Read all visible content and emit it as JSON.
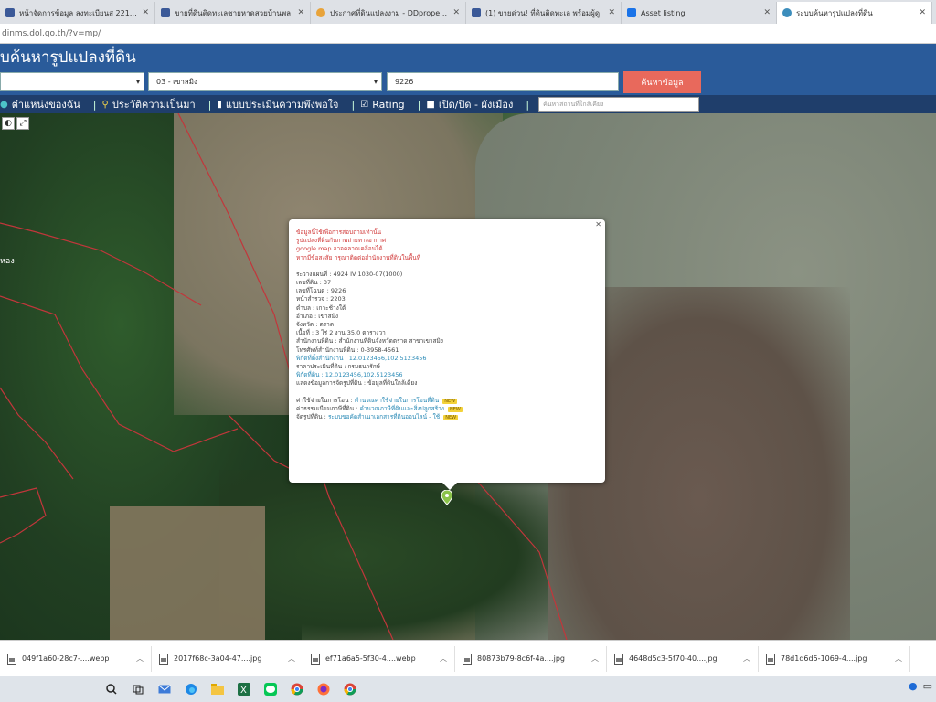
{
  "browser": {
    "tabs": [
      {
        "title": "หน้าจัดการข้อมูล ลงทะเบียนส 22113",
        "color": "#3b5998",
        "active": false
      },
      {
        "title": "ขายที่ดินติดทะเลชายหาดสวยบ้านพล",
        "color": "#3b5998",
        "active": false
      },
      {
        "title": "ประกาศที่ดินแปลงงาม - DDproperty",
        "color": "#e8a33a",
        "active": false
      },
      {
        "title": "(1) ขายด่วน! ที่ดินติดทะเล พร้อมผู้ดู",
        "color": "#3b5998",
        "active": false
      },
      {
        "title": "Asset listing",
        "color": "#1a73e8",
        "active": false
      },
      {
        "title": "ระบบค้นหารูปแปลงที่ดิน",
        "color": "#3c8dbc",
        "active": true
      }
    ],
    "url": "dinms.dol.go.th/?v=mp/"
  },
  "app": {
    "title": "บค้นหารูปแปลงที่ดิน"
  },
  "search": {
    "province_value": "",
    "district_value": "03 - เขาสมิง",
    "parcel_value": "9226",
    "button_label": "ค้นหาข้อมูล"
  },
  "menu": {
    "items": [
      {
        "label": "ตำแหน่งของฉัน",
        "icon": "location-icon"
      },
      {
        "label": "ประวัติความเป็นมา",
        "icon": "history-icon"
      },
      {
        "label": "แบบประเมินความพึงพอใจ",
        "icon": "form-icon"
      },
      {
        "label": "Rating",
        "icon": "checkbox-icon"
      },
      {
        "label": "เปิด/ปิด - ผังเมือง",
        "icon": "checkbox-icon"
      }
    ],
    "place_search_placeholder": "ค้นหาสถานที่ใกล้เคียง"
  },
  "map": {
    "label": "หอง"
  },
  "popup": {
    "warnings": [
      "ข้อมูลนี้ใช้เพื่อการสอบถามเท่านั้น",
      "รูปแปลงที่ดินกับภาพถ่ายทางอากาศ",
      "google map อาจคลาดเคลื่อนได้",
      "หากมีข้อสงสัย กรุณาติดต่อสำนักงานที่ดินในพื้นที่"
    ],
    "details": [
      "ระวางแผนที่ : 4924 IV 1030-07(1000)",
      "เลขที่ดิน : 37",
      "เลขที่โฉนด : 9226",
      "หน้าสำรวจ : 2203",
      "ตำบล : เกาะช้างใต้",
      "อำเภอ : เขาสมิง",
      "จังหวัด : ตราด",
      "เนื้อที่ : 3 ไร่ 2 งาน 35.0 ตารางวา",
      "สำนักงานที่ดิน : สำนักงานที่ดินจังหวัดตราด สาขาเขาสมิง",
      "โทรศัพท์สำนักงานที่ดิน : 0-3958-4561",
      "พิกัดที่ตั้งสำนักงาน : 12.0123456,102.5123456",
      "ราคาประเมินที่ดิน : กรมธนารักษ์",
      "พิกัดที่ดิน : 12.0123456,102.5123456",
      "แสดงข้อมูลการจัดรูปที่ดิน : ข้อมูลที่ดินใกล้เคียง"
    ],
    "links": [
      {
        "label": "ค่าใช้จ่ายในการโอน :",
        "value": "คำนวณค่าใช้จ่ายในการโอนที่ดิน",
        "badge": "NEW"
      },
      {
        "label": "ค่าธรรมเนียมภาษีที่ดิน :",
        "value": "คำนวณภาษีที่ดินและสิ่งปลูกสร้าง",
        "badge": "NEW"
      },
      {
        "label": "จัดรูปที่ดิน :",
        "value": "ระบบขอคัดสำเนาเอกสารที่ดินออนไลน์ - ใช้",
        "badge": "NEW"
      }
    ]
  },
  "downloads": [
    {
      "name": "049f1a60-28c7-....webp",
      "icon": "image-file-icon"
    },
    {
      "name": "2017f68c-3a04-47....jpg",
      "icon": "image-file-icon"
    },
    {
      "name": "ef71a6a5-5f30-4....webp",
      "icon": "image-file-icon"
    },
    {
      "name": "80873b79-8c6f-4a....jpg",
      "icon": "image-file-icon"
    },
    {
      "name": "4648d5c3-5f70-40....jpg",
      "icon": "image-file-icon"
    },
    {
      "name": "78d1d6d5-1069-4....jpg",
      "icon": "image-file-icon"
    }
  ],
  "taskbar": {
    "icons": [
      "search-icon",
      "task-view-icon",
      "mail-icon",
      "edge-icon",
      "file-explorer-icon",
      "excel-icon",
      "line-icon",
      "chrome-icon",
      "firefox-icon",
      "chrome-icon"
    ]
  },
  "colors": {
    "header_bg": "#2a5b9a",
    "menu_bg": "#1f3e6b",
    "search_button": "#e8695c",
    "warning_text": "#d13a3a",
    "link_text": "#2a8ab6"
  }
}
